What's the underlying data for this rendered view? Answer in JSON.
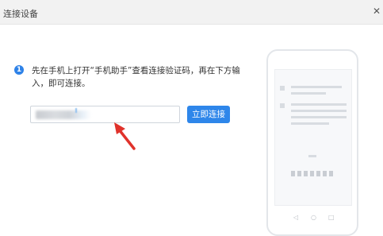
{
  "window": {
    "title": "连接设备",
    "close_icon": "close-icon"
  },
  "step": {
    "number": "1",
    "instruction": "先在手机上打开“手机助手”查看连接验证码，再在下方输入，即可连接。"
  },
  "code_input": {
    "value": "",
    "placeholder": ""
  },
  "connect_button": {
    "label": "立即连接"
  },
  "annotation": {
    "arrow_icon": "red-arrow-icon",
    "color": "#e0322b"
  },
  "phone_nav": {
    "back": "◁",
    "home": "○",
    "recent": "□"
  },
  "colors": {
    "accent": "#2e86ea",
    "arrow": "#e0322b"
  }
}
